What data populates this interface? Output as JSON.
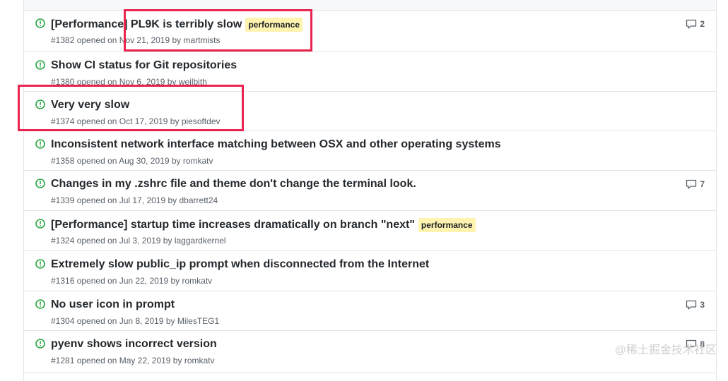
{
  "issues": [
    {
      "title": "[Performance] PL9K is terribly slow",
      "label": "performance",
      "meta": "#1382 opened on Nov 21, 2019 by ",
      "author": "martmists",
      "comments": "2"
    },
    {
      "title": "Show CI status for Git repositories",
      "label": "",
      "meta": "#1380 opened on Nov 6, 2019 by ",
      "author": "weilbith",
      "comments": ""
    },
    {
      "title": "Very very slow",
      "label": "",
      "meta": "#1374 opened on Oct 17, 2019 by ",
      "author": "piesoftdev",
      "comments": ""
    },
    {
      "title": "Inconsistent network interface matching between OSX and other operating systems",
      "label": "",
      "meta": "#1358 opened on Aug 30, 2019 by ",
      "author": "romkatv",
      "comments": ""
    },
    {
      "title": "Changes in my .zshrc file and theme don't change the terminal look.",
      "label": "",
      "meta": "#1339 opened on Jul 17, 2019 by ",
      "author": "dbarrett24",
      "comments": "7"
    },
    {
      "title": "[Performance] startup time increases dramatically on branch \"next\"",
      "label": "performance",
      "meta": "#1324 opened on Jul 3, 2019 by ",
      "author": "laggardkernel",
      "comments": ""
    },
    {
      "title": "Extremely slow public_ip prompt when disconnected from the Internet",
      "label": "",
      "meta": "#1316 opened on Jun 22, 2019 by ",
      "author": "romkatv",
      "comments": ""
    },
    {
      "title": "No user icon in prompt",
      "label": "",
      "meta": "#1304 opened on Jun 8, 2019 by ",
      "author": "MilesTEG1",
      "comments": "3"
    },
    {
      "title": "pyenv shows incorrect version",
      "label": "",
      "meta": "#1281 opened on May 22, 2019 by ",
      "author": "romkatv",
      "comments": "8"
    }
  ],
  "watermark": "@稀土掘金技术社区",
  "colors": {
    "open_icon": "#28a745",
    "label_bg": "#fff3b0",
    "highlight": "#e8244f"
  }
}
